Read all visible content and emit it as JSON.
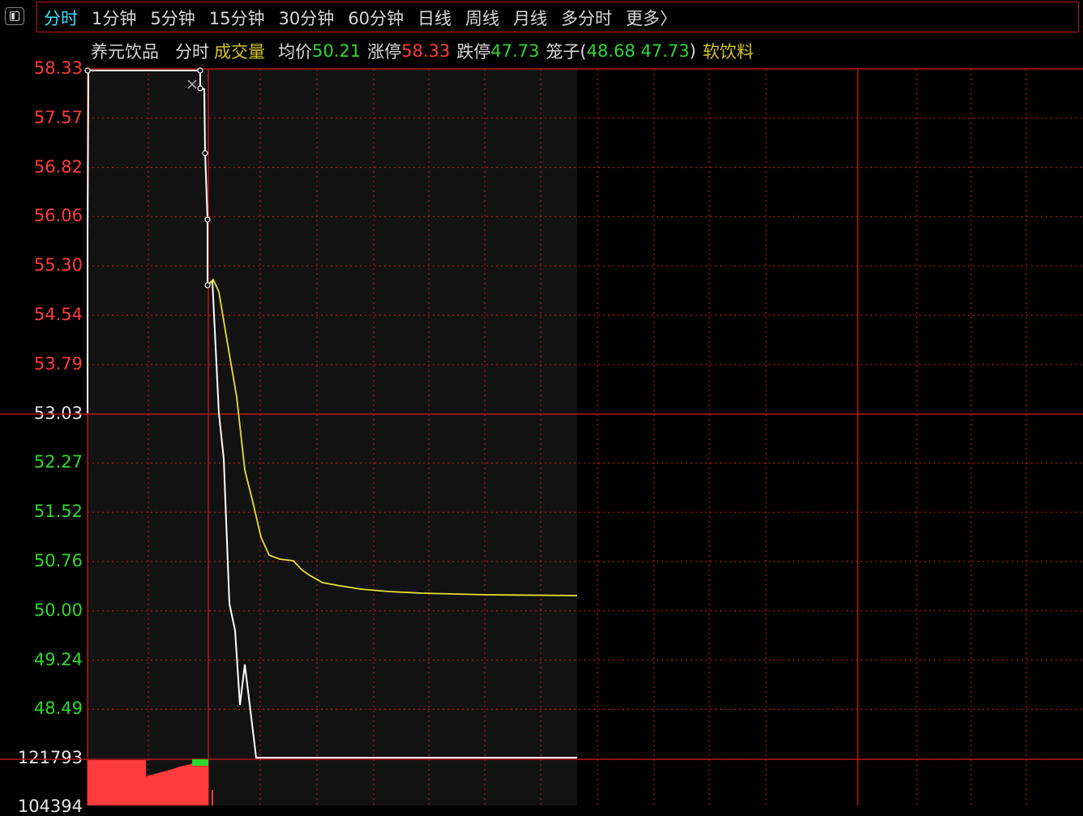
{
  "toolbar": {
    "tabs": [
      {
        "label": "分时",
        "active": true
      },
      {
        "label": "1分钟",
        "active": false
      },
      {
        "label": "5分钟",
        "active": false
      },
      {
        "label": "15分钟",
        "active": false
      },
      {
        "label": "30分钟",
        "active": false
      },
      {
        "label": "60分钟",
        "active": false
      },
      {
        "label": "日线",
        "active": false
      },
      {
        "label": "周线",
        "active": false
      },
      {
        "label": "月线",
        "active": false
      },
      {
        "label": "多分时",
        "active": false
      },
      {
        "label": "更多〉",
        "active": false
      }
    ]
  },
  "info": {
    "stock_name": "养元饮品",
    "mode": "分时",
    "indicator": "成交量",
    "avg_label": "均价",
    "avg_value": "50.21",
    "limit_up_label": "涨停",
    "limit_up_value": "58.33",
    "limit_down_label": "跌停",
    "limit_down_value": "47.73",
    "cage_label": "笼子(",
    "cage_values": "48.68 47.73",
    "cage_close": ")",
    "sector": "软饮料"
  },
  "axis": {
    "price_labels": [
      {
        "text": "58.33",
        "color": "red"
      },
      {
        "text": "57.57",
        "color": "red"
      },
      {
        "text": "56.82",
        "color": "red"
      },
      {
        "text": "56.06",
        "color": "red"
      },
      {
        "text": "55.30",
        "color": "red"
      },
      {
        "text": "54.54",
        "color": "red"
      },
      {
        "text": "53.79",
        "color": "red"
      },
      {
        "text": "53.03",
        "color": "white"
      },
      {
        "text": "52.27",
        "color": "green"
      },
      {
        "text": "51.52",
        "color": "green"
      },
      {
        "text": "50.76",
        "color": "green"
      },
      {
        "text": "50.00",
        "color": "green"
      },
      {
        "text": "49.24",
        "color": "green"
      },
      {
        "text": "48.49",
        "color": "green"
      }
    ],
    "volume_labels": [
      "121793",
      "104394"
    ]
  },
  "colors": {
    "grid_red": "#b81818",
    "price_line": "#ffffff",
    "avg_line": "#e8e030",
    "up_red": "#ff3b3b",
    "down_green": "#2ed82e",
    "panel_bg": "#121212"
  }
}
